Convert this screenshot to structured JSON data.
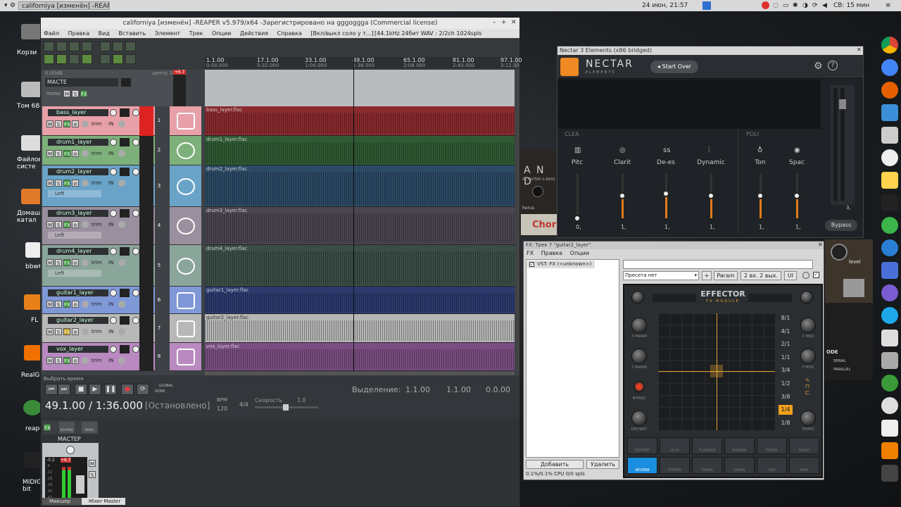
{
  "topbar": {
    "app_title": "californiya [изменён] -REAPER",
    "clock": "24 июн, 21:57",
    "user_time": "СВ: 15 мин"
  },
  "desktop": {
    "icons": [
      {
        "label": "Корзи"
      },
      {
        "label": "Том 684"
      },
      {
        "label": "Файлов систе"
      },
      {
        "label": "Домаш катал"
      },
      {
        "label": "bbw6"
      },
      {
        "label": "FL"
      },
      {
        "label": "RealGui"
      },
      {
        "label": "reape"
      },
      {
        "label": "MIDIGuitar bit"
      }
    ]
  },
  "reaper": {
    "title": "californiya [изменён] -REAPER v5.979/x64 -Зарегистрировано на gggoggga (Commercial license)",
    "menu": [
      "Файл",
      "Правка",
      "Вид",
      "Вставить",
      "Элемент",
      "Трек",
      "Опции",
      "Действия",
      "Справка",
      "[Вкл/выкл соло у т...]"
    ],
    "status": "[44.1kHz 24бит WAV : 2/2ch 1024spls ~43/187ms WaveOut]",
    "ruler": [
      {
        "bar": "1.1.00",
        "time": "0:00.000"
      },
      {
        "bar": "17.1.00",
        "time": "0:32.000"
      },
      {
        "bar": "33.1.00",
        "time": "1:04.000"
      },
      {
        "bar": "49.1.00",
        "time": "1:36.000"
      },
      {
        "bar": "65.1.00",
        "time": "2:08.000"
      },
      {
        "bar": "81.1.00",
        "time": "2:40.000"
      },
      {
        "bar": "97.1.00",
        "time": "3:12.00"
      }
    ],
    "master": {
      "name": "МАСТЕ",
      "db": "0.00dB",
      "center": "центр 100W",
      "mono": "mono",
      "peak": "+6.7"
    },
    "tracks": [
      {
        "num": "1",
        "name": "bass_layer",
        "file": "bass_layer.flac",
        "mode": "",
        "color": "#e8a0a8",
        "lane": "#8a2a2e"
      },
      {
        "num": "2",
        "name": "drum1_layer",
        "file": "drum1_layer.flac",
        "mode": "",
        "color": "#7db07a",
        "lane": "#2f5a33"
      },
      {
        "num": "3",
        "name": "drum2_layer",
        "file": "drum2_layer.flac",
        "mode": "Left",
        "color": "#6aa3c8",
        "lane": "#2b4a66"
      },
      {
        "num": "4",
        "name": "drum3_layer",
        "file": "drum3_layer.flac",
        "mode": "Left",
        "color": "#9a8f9e",
        "lane": "#4b4550"
      },
      {
        "num": "5",
        "name": "drum4_layer",
        "file": "drum4_layer.flac",
        "mode": "Left",
        "color": "#8aa59a",
        "lane": "#3b4e46"
      },
      {
        "num": "6",
        "name": "guitar1_layer",
        "file": "guitar1_layer.flac",
        "mode": "",
        "color": "#7f98d8",
        "lane": "#2c3a6e"
      },
      {
        "num": "7",
        "name": "guitar2_layer",
        "file": "guitar2_layer.flac",
        "mode": "",
        "color": "#b8b8b8",
        "lane": "#b6b6b6"
      },
      {
        "num": "8",
        "name": "vox_layer",
        "file": "vox_layer.flac",
        "mode": "",
        "color": "#b88ac0",
        "lane": "#7a4e82"
      }
    ],
    "track_buttons": {
      "m": "M",
      "s": "S",
      "fx": "FX",
      "trim": "trim",
      "in": "IN",
      "route": "ROUTE"
    },
    "transport": {
      "hint": "Выбрать время",
      "position": "49.1.00 / 1:36.000",
      "state": "[Остановлено]",
      "bpm_label": "BPM",
      "bpm": "120",
      "sig": "4/4",
      "rate_label": "Скорость",
      "rate": "1.0",
      "selection_label": "Выделение:",
      "sel_start": "1.1.00",
      "sel_end": "1.1.00",
      "sel_len": "0.0.00",
      "global": "GLOBAL",
      "none": "NONE"
    },
    "mixer": {
      "master_label": "МАСТЕР",
      "routing": "ROUTING",
      "mono": "MONO",
      "fx": "FX",
      "peak_l": "-0.2",
      "peak_r": "+6.7",
      "m": "M",
      "s": "S",
      "tabs": [
        "Микшер",
        "Mixer Master"
      ],
      "scale": [
        "-6",
        "-12",
        "-18",
        "-24",
        "-30",
        "-42"
      ]
    }
  },
  "nectar": {
    "title": "Nectar 3 Elements (x86 bridged)",
    "brand": "NECTAR",
    "sub": "ELEMENTS",
    "start_over": "Start Over",
    "group_left": "CLEA",
    "group_right": "POLI",
    "modules": [
      {
        "name": "Pitc",
        "value": "0,",
        "level": 0.0
      },
      {
        "name": "Clarit",
        "value": "1,",
        "level": 0.5
      },
      {
        "name": "De-es",
        "value": "1,",
        "level": 0.55
      },
      {
        "name": "Dynamic",
        "value": "1,",
        "level": 0.5
      },
      {
        "name": "Ton",
        "value": "1,",
        "level": 0.5
      },
      {
        "name": "Spac",
        "value": "1,",
        "level": 0.5
      }
    ],
    "output_value": "3,",
    "bypass": "Bypass"
  },
  "fx": {
    "title": "FX: Трек 7 \"guitar2_layer\"",
    "menu": [
      "FX",
      "Правка",
      "Опции"
    ],
    "list": [
      "VST: FX (<unknown>)"
    ],
    "preset": "Пресета нет",
    "plus": "+",
    "param": "Param",
    "io": "2 вх. 2 вых.",
    "ui": "UI",
    "add": "Добавить",
    "remove": "Удалить",
    "cpu": "0.1%/0.1% CPU 0/0 spls",
    "effector": {
      "title": "EFFECTOR",
      "subtitle": "FX MODULE",
      "knob_labels": [
        "X PARAM",
        "Y PARAM",
        "BYPASS",
        "DRY/WET",
        "X MOD",
        "Y MOD",
        "TEMPO"
      ],
      "rates": [
        "8/1",
        "4/1",
        "2/1",
        "1/1",
        "3/4",
        "1/2",
        "3/8",
        "1/4",
        "1/8"
      ],
      "active_rate": "1/4",
      "effects": [
        "DISTORT",
        "LO-FI",
        "FLANGER",
        "PHASER",
        "FILTER",
        "DELAY",
        "REVERB",
        "STEREO",
        "TRANS",
        "GRAIN",
        "VOX",
        "RING"
      ],
      "active_effect": "REVERB"
    }
  },
  "backdrop": {
    "chor": "Chor",
    "ande": "A N D",
    "ande_sub": "AL GUITAR & BASS",
    "horus": "horus",
    "level": "level",
    "ode": "ODE",
    "serial": "SERIAL",
    "parallel": "PARALLEL"
  }
}
